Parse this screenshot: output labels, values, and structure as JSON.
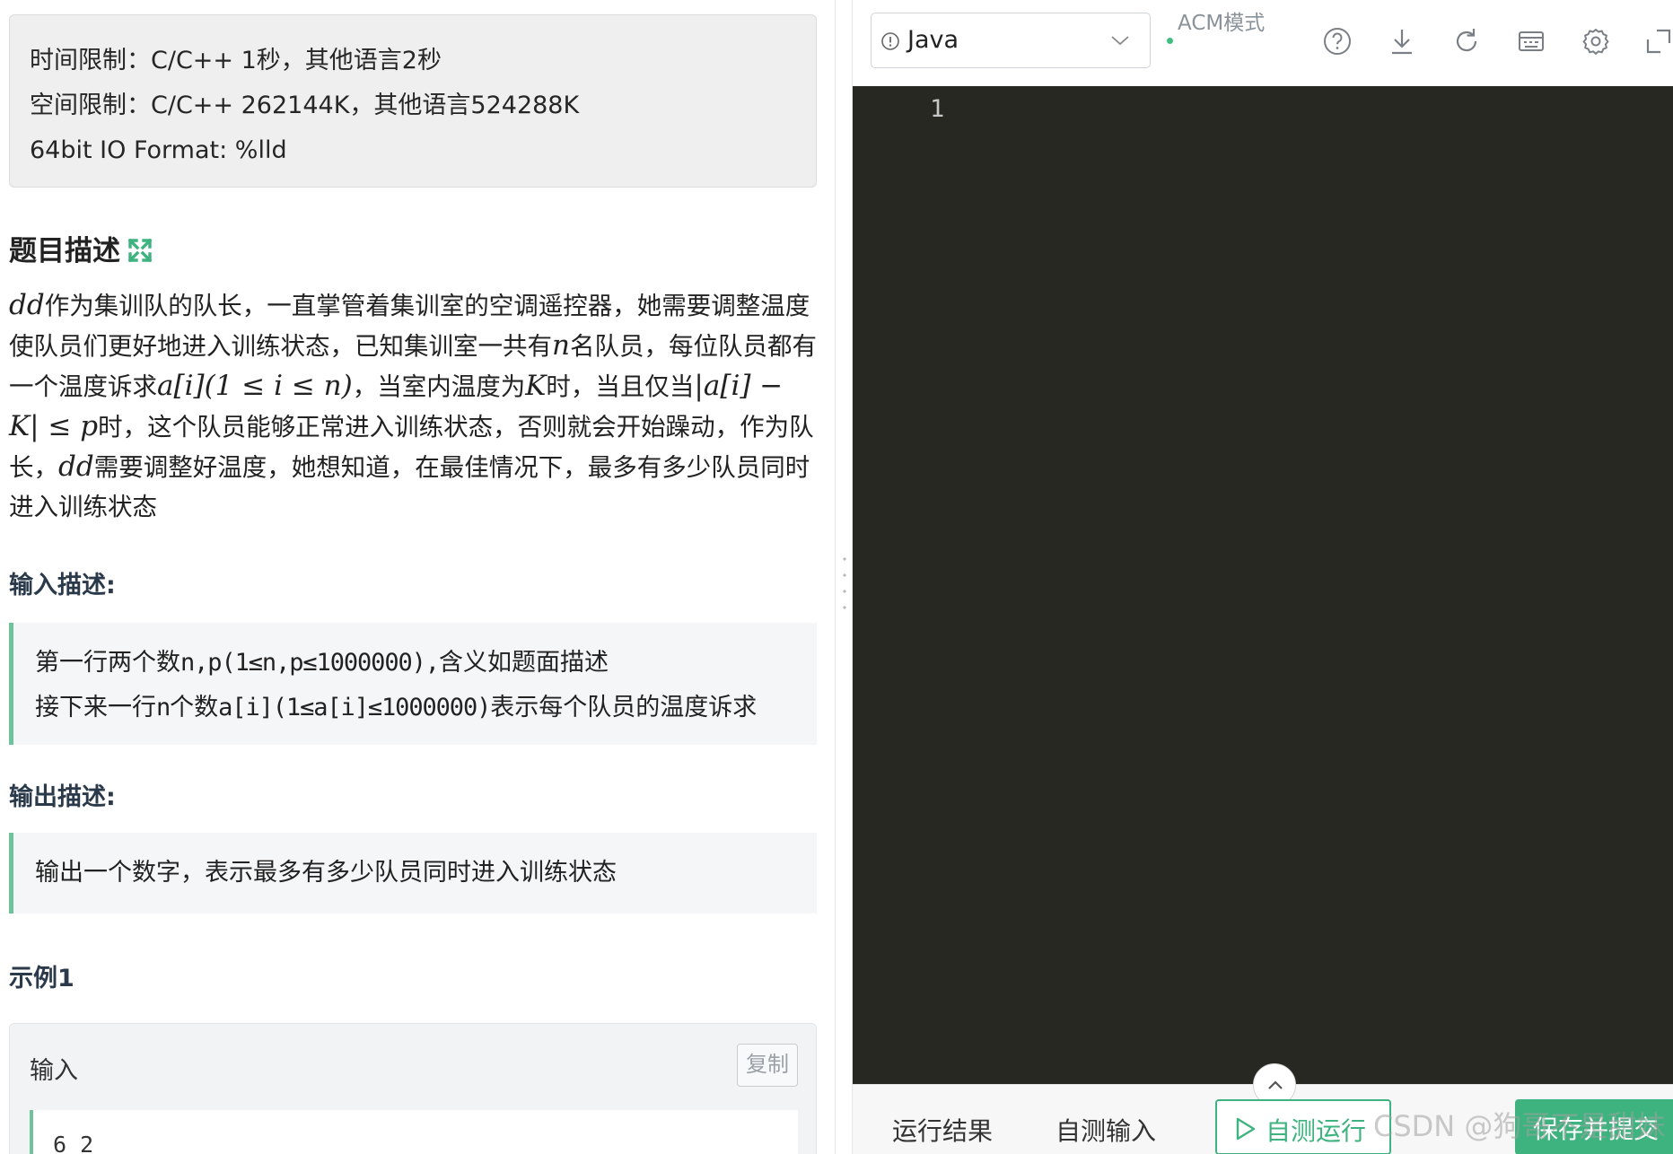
{
  "limits": {
    "time": "时间限制：C/C++ 1秒，其他语言2秒",
    "space": "空间限制：C/C++ 262144K，其他语言524288K",
    "io": "64bit IO Format: %lld"
  },
  "problem": {
    "title": "题目描述",
    "desc": {
      "p1": "dd",
      "p2": "作为集训队的队长，一直掌管着集训室的空调遥控器，她需要调整温度使队员们更好地进入训练状态，已知集训室一共有",
      "p3": "n",
      "p4": "名队员，每位队员都有一个温度诉求",
      "p5": "a[i](1 ≤ i ≤ n)",
      "p6": "，当室内温度为",
      "p7": "K",
      "p8": "时，当且仅当",
      "p9": "|a[i] − K| ≤ p",
      "p10": "时，这个队员能够正常进入训练状态，否则就会开始躁动，作为队长，",
      "p11": "dd",
      "p12": "需要调整好温度，她想知道，在最佳情况下，最多有多少队员同时进入训练状态"
    }
  },
  "input_desc": {
    "title": "输入描述:",
    "line1_cn": "第一行两个数",
    "line1_code": "n,p(1≤n,p≤1000000),",
    "line1_tail": "含义如题面描述",
    "line2_cn": "接下来一行",
    "line2_code1": "n",
    "line2_cn2": "个数",
    "line2_code2": "a[i](1≤a[i]≤1000000)",
    "line2_tail": "表示每个队员的温度诉求"
  },
  "output_desc": {
    "title": "输出描述:",
    "line1": "输出一个数字，表示最多有多少队员同时进入训练状态"
  },
  "example": {
    "title": "示例1",
    "input_label": "输入",
    "copy_label": "复制",
    "input_value": "6 2"
  },
  "editor": {
    "language": "Java",
    "mode": "ACM模式",
    "line_number": "1"
  },
  "bottom": {
    "tab_result": "运行结果",
    "tab_input": "自测输入",
    "run_label": "自测运行",
    "submit_label": "保存并提交"
  },
  "watermark": "CSDN @狗哥不是甜妹",
  "colors": {
    "accent": "#3fb37f",
    "editor_bg": "#272822",
    "quote_border": "#6fc39a"
  }
}
